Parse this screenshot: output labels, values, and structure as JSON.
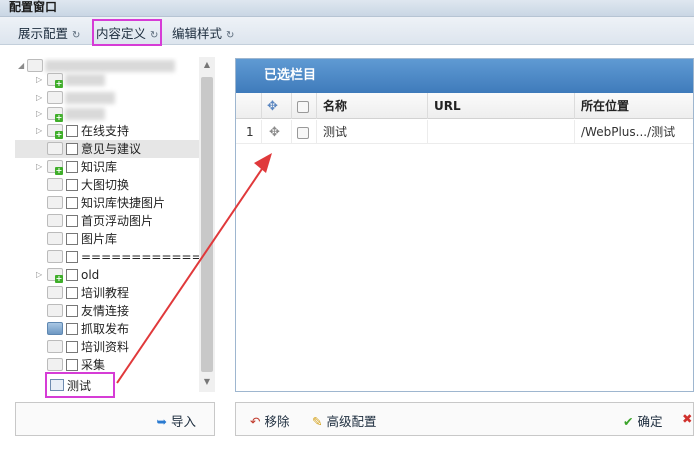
{
  "window": {
    "title": "配置窗口"
  },
  "tabs": [
    {
      "label": "展示配置",
      "refresh": "↻"
    },
    {
      "label": "内容定义",
      "refresh": "↻"
    },
    {
      "label": "编辑样式",
      "refresh": "↻"
    }
  ],
  "tree": {
    "items": [
      {
        "label": "在线支持"
      },
      {
        "label": "意见与建议"
      },
      {
        "label": "知识库"
      },
      {
        "label": "大图切换"
      },
      {
        "label": "知识库快捷图片"
      },
      {
        "label": "首页浮动图片"
      },
      {
        "label": "图片库"
      },
      {
        "label": "============="
      },
      {
        "label": "old"
      },
      {
        "label": "培训教程"
      },
      {
        "label": "友情连接"
      },
      {
        "label": "抓取发布"
      },
      {
        "label": "培训资料"
      },
      {
        "label": "采集"
      }
    ],
    "test_item": "测试"
  },
  "import_button": {
    "label": "导入",
    "icon": "import-arrow-icon"
  },
  "grid": {
    "title": "已选栏目",
    "columns": [
      "名称",
      "URL",
      "所在位置"
    ],
    "rows": [
      {
        "index": "1",
        "name": "测试",
        "url": "",
        "location": "/WebPlus.../测试"
      }
    ]
  },
  "toolbar": {
    "remove_label": "移除",
    "advanced_label": "高级配置",
    "confirm_label": "确定"
  },
  "colors": {
    "highlight": "#d63cd6",
    "arrow": "#e0393b",
    "header_blue": "#4a86c6"
  }
}
